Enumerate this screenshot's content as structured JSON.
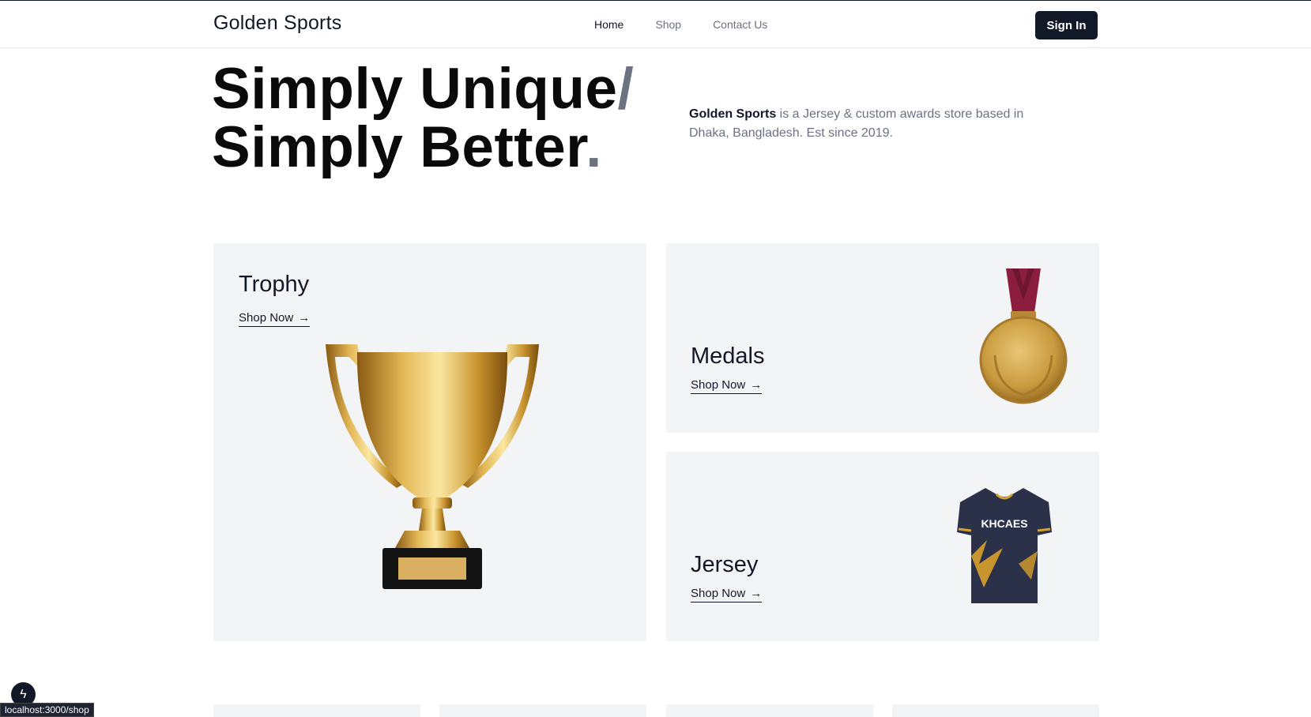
{
  "header": {
    "brand": "Golden Sports",
    "nav": [
      {
        "label": "Home",
        "active": true
      },
      {
        "label": "Shop",
        "active": false
      },
      {
        "label": "Contact Us",
        "active": false
      }
    ],
    "signin_label": "Sign In"
  },
  "hero": {
    "line1": "Simply Unique",
    "line1_accent": "/",
    "line2": "Simply Better",
    "line2_accent": ".",
    "desc_bold": "Golden Sports",
    "desc_rest": " is a Jersey & custom awards store based in Dhaka, Bangladesh. Est since 2019."
  },
  "categories": [
    {
      "title": "Trophy",
      "link": "Shop Now",
      "icon": "trophy-image"
    },
    {
      "title": "Medals",
      "link": "Shop Now",
      "icon": "medal-image"
    },
    {
      "title": "Jersey",
      "link": "Shop Now",
      "icon": "jersey-image"
    }
  ],
  "jersey_print": "KHCAES",
  "status_url": "localhost:3000/shop",
  "colors": {
    "primary": "#111827",
    "muted": "#6b7280",
    "card_bg": "#f3f4f6",
    "gold": "#d4a437",
    "ribbon": "#8b1e3f",
    "jersey": "#2a3149"
  }
}
